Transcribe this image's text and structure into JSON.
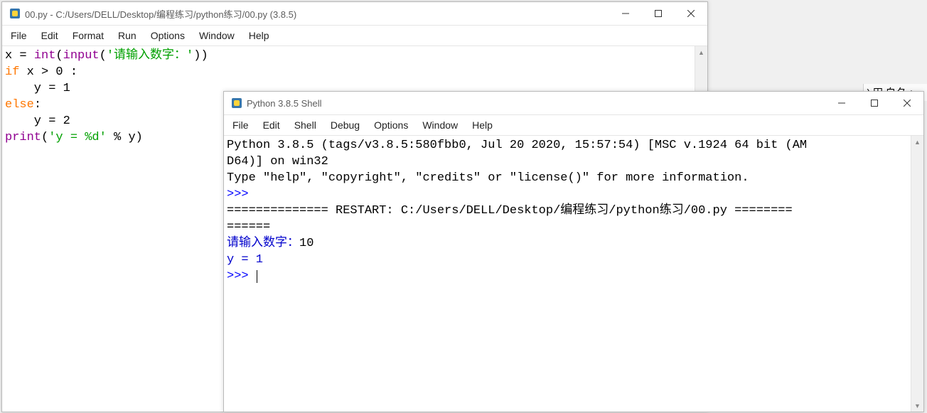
{
  "editor": {
    "title": "00.py - C:/Users/DELL/Desktop/编程练习/python练习/00.py (3.8.5)",
    "menus": [
      "File",
      "Edit",
      "Format",
      "Run",
      "Options",
      "Window",
      "Help"
    ],
    "code": {
      "l1_x": "x ",
      "l1_eq": "= ",
      "l1_int": "int",
      "l1_p1": "(",
      "l1_input": "input",
      "l1_p2": "(",
      "l1_str": "'请输入数字：'",
      "l1_p3": "))",
      "l2_if": "if",
      "l2_rest": " x > 0 :",
      "l3": "    y = 1",
      "l4_else": "else",
      "l4_colon": ":",
      "l5": "    y = 2",
      "l6_print": "print",
      "l6_p1": "(",
      "l6_str": "'y = %d'",
      "l6_rest": " % y)"
    }
  },
  "shell": {
    "title": "Python 3.8.5 Shell",
    "menus": [
      "File",
      "Edit",
      "Shell",
      "Debug",
      "Options",
      "Window",
      "Help"
    ],
    "banner1": "Python 3.8.5 (tags/v3.8.5:580fbb0, Jul 20 2020, 15:57:54) [MSC v.1924 64 bit (AM",
    "banner2": "D64)] on win32",
    "banner3": "Type \"help\", \"copyright\", \"credits\" or \"license()\" for more information.",
    "prompt": ">>> ",
    "restart1": "============== RESTART: C:/Users/DELL/Desktop/编程练习/python练习/00.py ========",
    "restart2": "======",
    "input_prompt": "请输入数字：",
    "input_val": "10",
    "output": "y = 1"
  },
  "bg_snip": ") 田 白夕  +、"
}
